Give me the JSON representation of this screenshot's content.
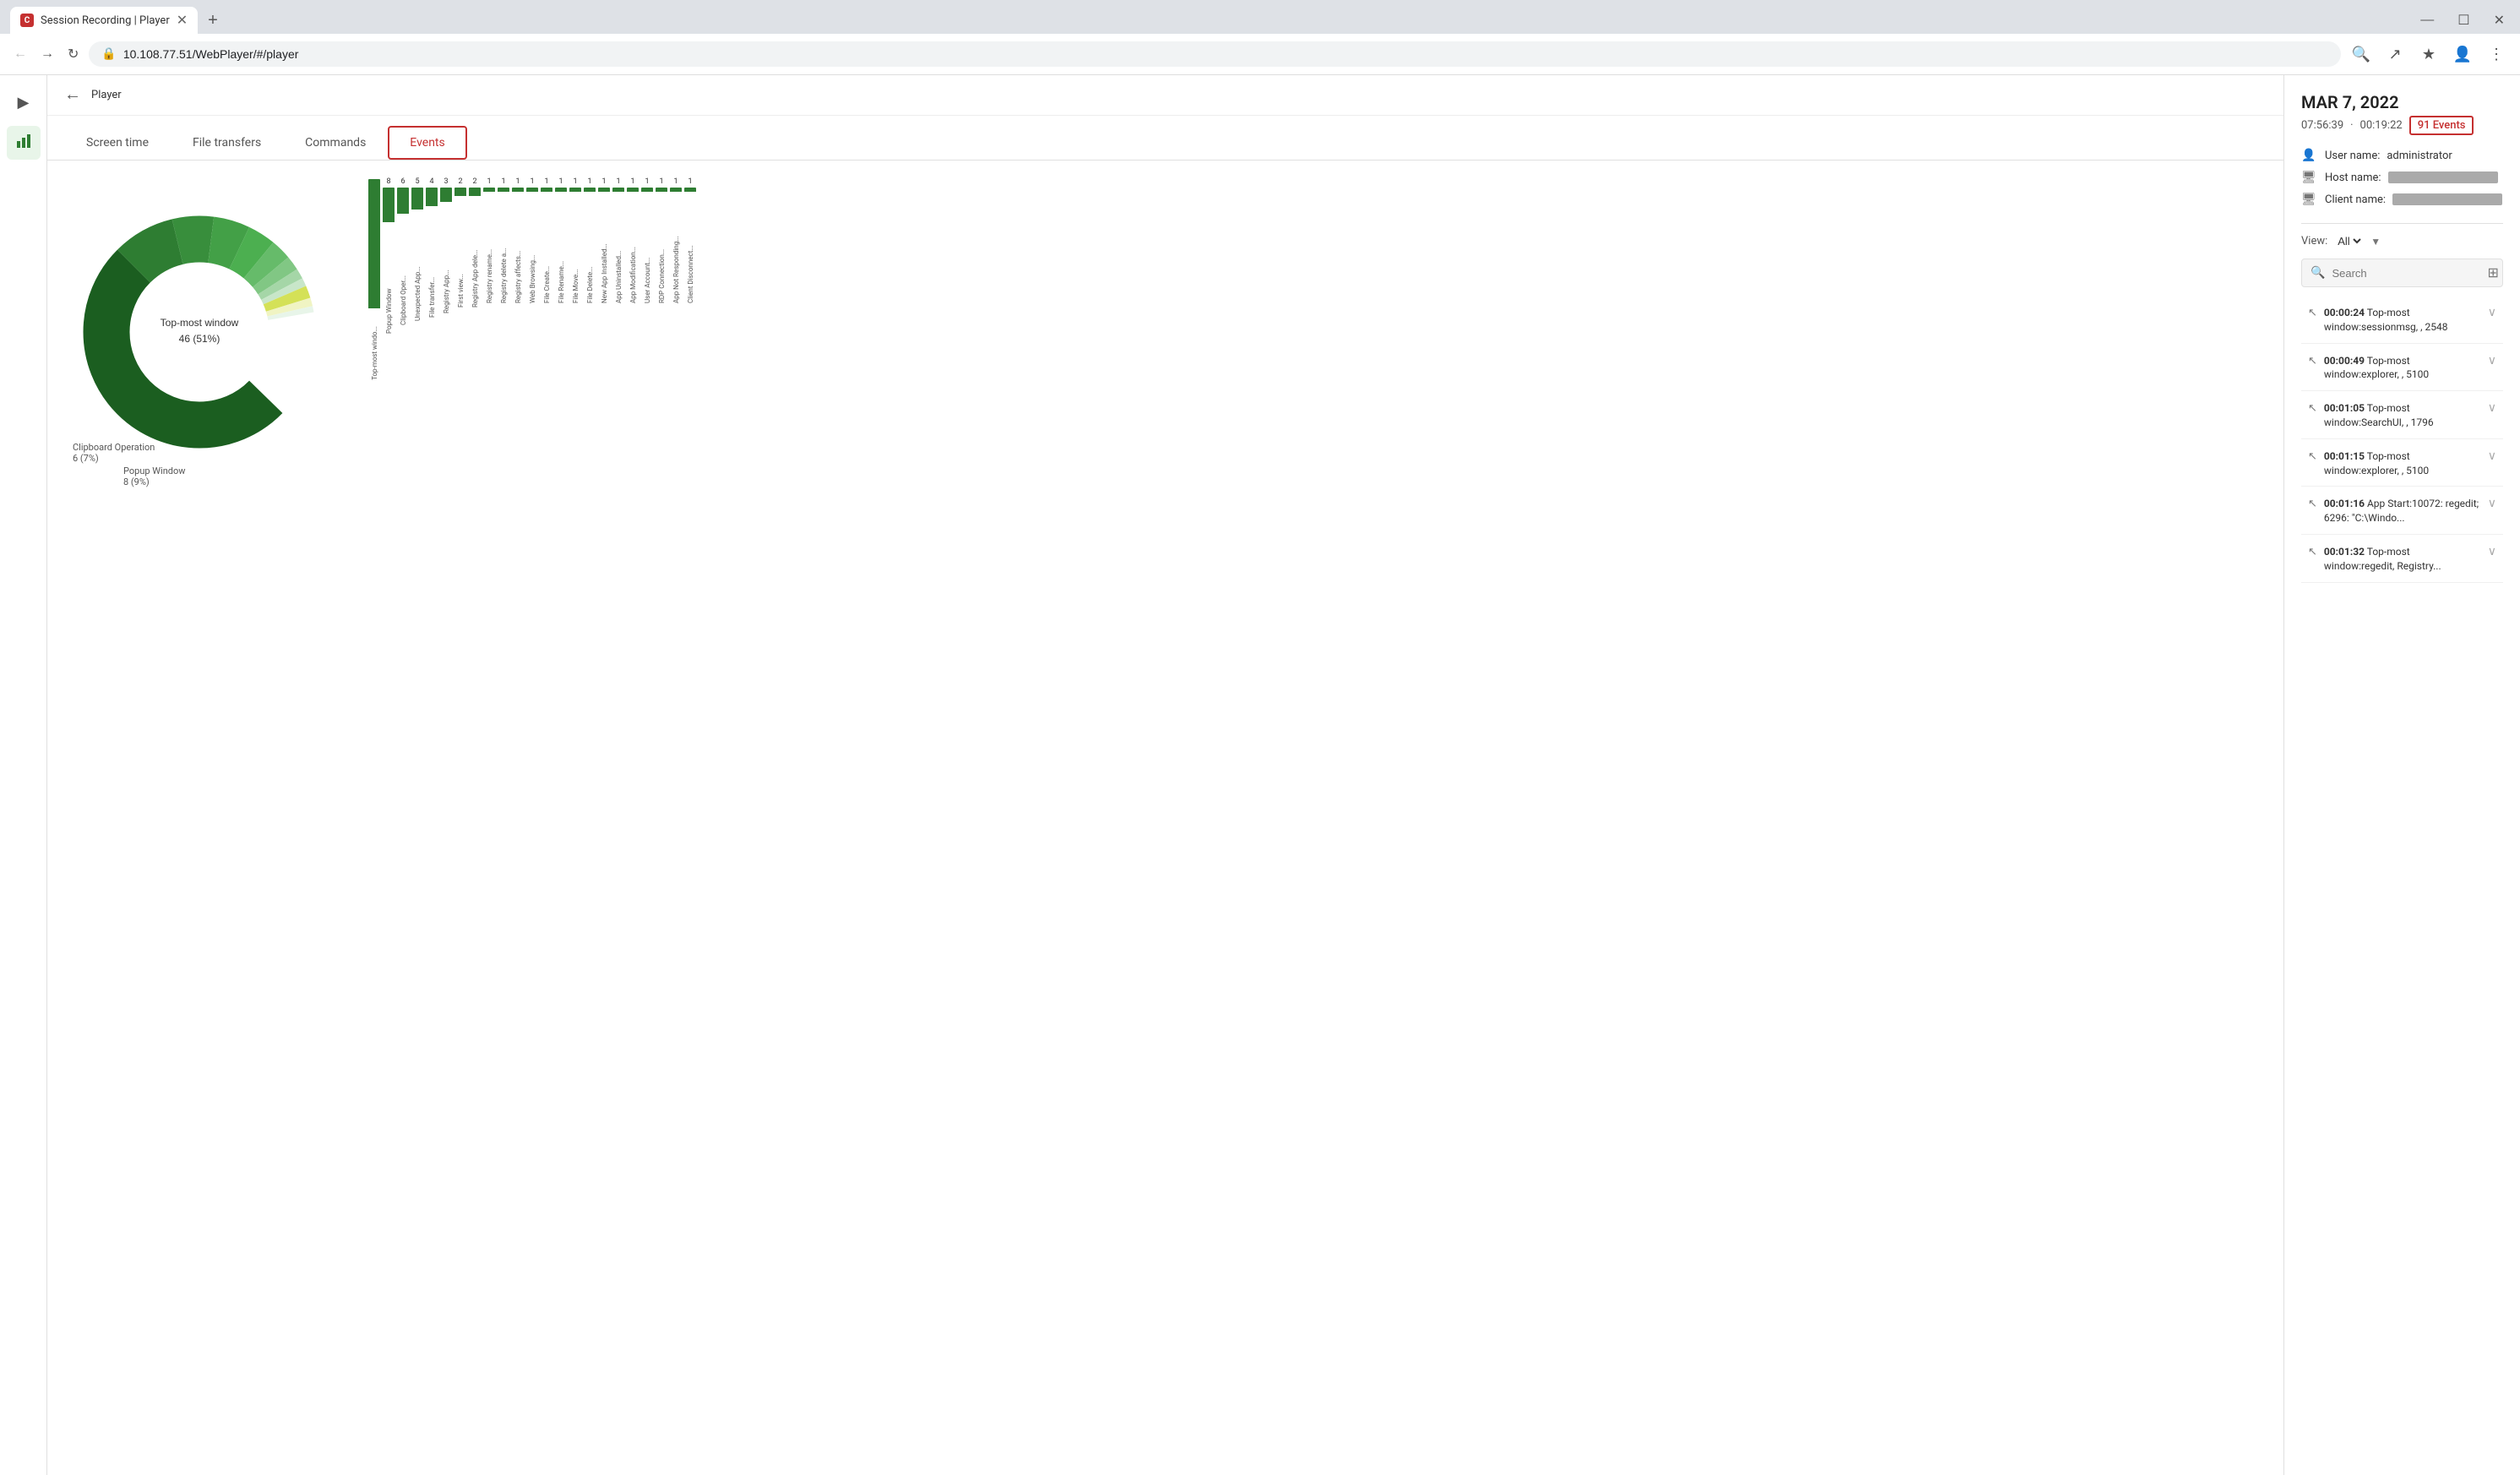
{
  "browser": {
    "tab_title": "Session Recording | Player",
    "favicon_letter": "C",
    "url": "10.108.77.51/WebPlayer/#/player",
    "new_tab_label": "+",
    "win_minimize": "—",
    "win_restore": "☐",
    "win_close": "✕"
  },
  "app": {
    "back_label": "←",
    "page_title": "Player",
    "tabs": [
      {
        "id": "screen-time",
        "label": "Screen time",
        "active": false
      },
      {
        "id": "file-transfers",
        "label": "File transfers",
        "active": false
      },
      {
        "id": "commands",
        "label": "Commands",
        "active": false
      },
      {
        "id": "events",
        "label": "Events",
        "active": true
      }
    ]
  },
  "sidebar": {
    "items": [
      {
        "id": "play",
        "icon": "▶",
        "label": "Play"
      },
      {
        "id": "stats",
        "icon": "📊",
        "label": "Stats"
      }
    ]
  },
  "session": {
    "date": "MAR 7, 2022",
    "time": "07:56:39",
    "duration": "00:19:22",
    "events_count": "91 Events",
    "user_label": "User name:",
    "user_value": "administrator",
    "host_label": "Host name:",
    "client_label": "Client name:"
  },
  "view": {
    "label": "View:",
    "value": "All"
  },
  "search": {
    "placeholder": "Search",
    "filter_icon": "⊞"
  },
  "events_list": [
    {
      "time": "00:00:24",
      "text": "Top-most window:sessionmsg, , 2548"
    },
    {
      "time": "00:00:49",
      "text": "Top-most window:explorer, , 5100"
    },
    {
      "time": "00:01:05",
      "text": "Top-most window:SearchUI, , 1796"
    },
    {
      "time": "00:01:15",
      "text": "Top-most window:explorer, , 5100"
    },
    {
      "time": "00:01:16",
      "text": "App Start:10072: regedit; 6296: \"C:\\Windo..."
    },
    {
      "time": "00:01:32",
      "text": "Top-most window:regedit, Registry..."
    }
  ],
  "donut": {
    "center_label": "Top-most window",
    "center_value": "46 (51%)",
    "labels": [
      {
        "text": "Clipboard Operation",
        "value": "6 (7%)"
      },
      {
        "text": "Popup Window",
        "value": "8 (9%)"
      }
    ]
  },
  "bars": [
    {
      "label": "Top-most windo...",
      "value": 46,
      "max": 46
    },
    {
      "label": "Popup Window",
      "value": 8
    },
    {
      "label": "Clipboard Oper...",
      "value": 6
    },
    {
      "label": "Unexpected App...",
      "value": 5
    },
    {
      "label": "File transfer...",
      "value": 4
    },
    {
      "label": "Registry App...",
      "value": 3
    },
    {
      "label": "First view...",
      "value": 2
    },
    {
      "label": "Registry App dele...",
      "value": 2
    },
    {
      "label": "Registry rename...",
      "value": 1
    },
    {
      "label": "Registry delete a...",
      "value": 1
    },
    {
      "label": "Registry affects...",
      "value": 1
    },
    {
      "label": "Web Browsing...",
      "value": 1
    },
    {
      "label": "File Create...",
      "value": 1
    },
    {
      "label": "File Rename...",
      "value": 1
    },
    {
      "label": "File Move...",
      "value": 1
    },
    {
      "label": "File Delete...",
      "value": 1
    },
    {
      "label": "New App Installed...",
      "value": 1
    },
    {
      "label": "App Uninstalled...",
      "value": 1
    },
    {
      "label": "App Modification...",
      "value": 1
    },
    {
      "label": "User Account...",
      "value": 1
    },
    {
      "label": "RDP Connection...",
      "value": 1
    },
    {
      "label": "App Not Responding...",
      "value": 1
    },
    {
      "label": "Client Disconnect...",
      "value": 1
    }
  ]
}
